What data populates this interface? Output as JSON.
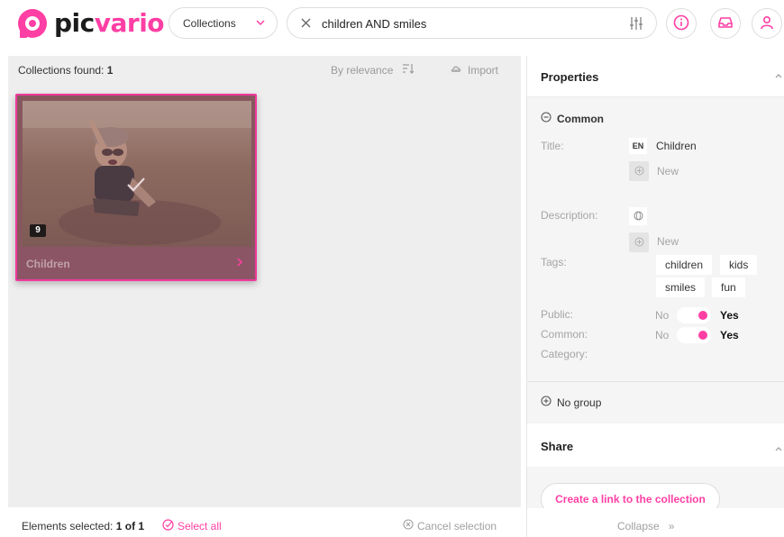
{
  "brand": {
    "logo_text_a": "pic",
    "logo_text_b": "vario",
    "accent": "#ff3fa4"
  },
  "header": {
    "scope_select": {
      "value": "Collections"
    },
    "search": {
      "value": "children AND smiles"
    },
    "icons": [
      "clear-icon",
      "filters-icon",
      "info-icon",
      "inbox-icon",
      "user-icon"
    ]
  },
  "results": {
    "found_label": "Collections found:",
    "found_count": "1",
    "sort_label": "By relevance",
    "import_label": "Import",
    "cards": [
      {
        "name": "Children",
        "count": "9",
        "selected": true
      }
    ]
  },
  "bottom_bar": {
    "selected_label": "Elements selected:",
    "selected_value": "1 of 1",
    "select_all": "Select all",
    "cancel_selection": "Cancel selection"
  },
  "properties": {
    "title": "Properties",
    "common_section": "Common",
    "fields": {
      "title_label": "Title:",
      "lang_code": "EN",
      "title_value": "Children",
      "new_label": "New",
      "description_label": "Description:",
      "tags_label": "Tags:",
      "public_label": "Public:",
      "common_label": "Common:",
      "category_label": "Category:"
    },
    "tags": [
      "children",
      "kids",
      "smiles",
      "fun"
    ],
    "toggles": {
      "public": {
        "off": "No",
        "on": "Yes",
        "value": true
      },
      "common": {
        "off": "No",
        "on": "Yes",
        "value": true
      }
    },
    "no_group": "No group"
  },
  "share": {
    "title": "Share",
    "create_link": "Create a link to the collection"
  },
  "collapse": {
    "label": "Collapse",
    "icon": "»"
  }
}
